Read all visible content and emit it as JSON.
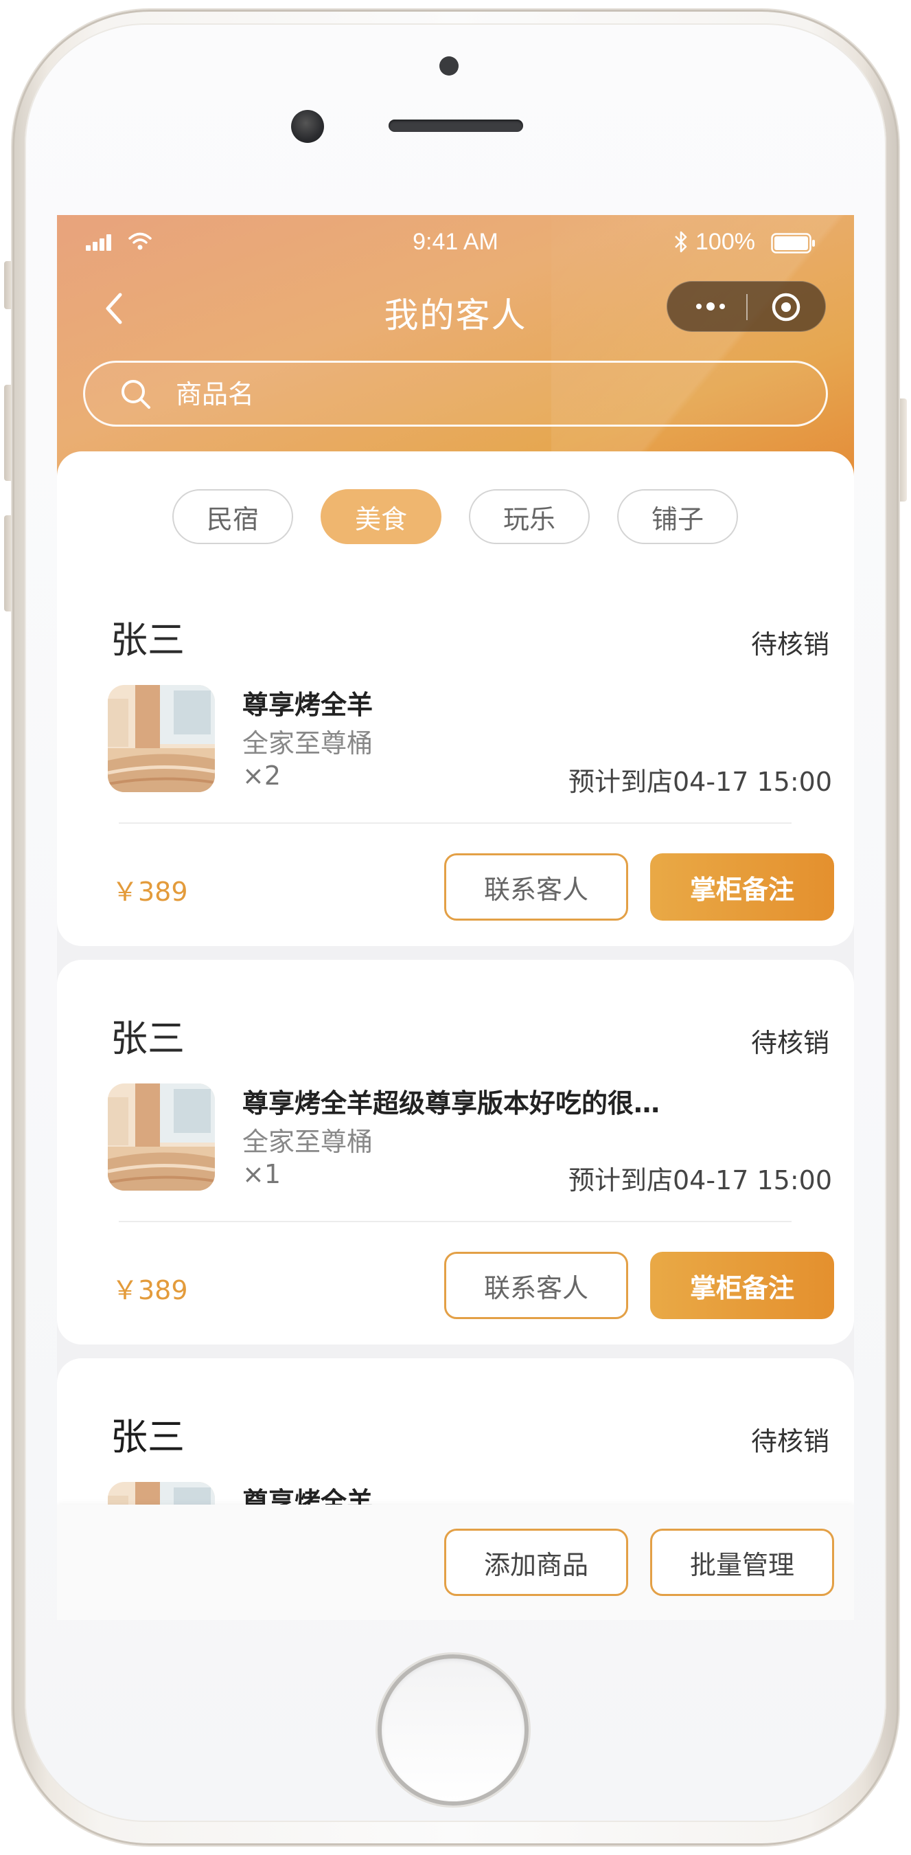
{
  "status_bar": {
    "time": "9:41 AM",
    "battery": "100%"
  },
  "nav": {
    "title": "我的客人"
  },
  "search": {
    "placeholder": "商品名"
  },
  "tabs": [
    {
      "label": "民宿",
      "active": false
    },
    {
      "label": "美食",
      "active": true
    },
    {
      "label": "玩乐",
      "active": false
    },
    {
      "label": "铺子",
      "active": false
    }
  ],
  "orders": [
    {
      "name": "张三",
      "status": "待核销",
      "product_title": "尊享烤全羊",
      "product_spec": "全家至尊桶",
      "quantity": "×2",
      "arrival": "预计到店04-17 15:00",
      "price": "￥389",
      "contact_label": "联系客人",
      "note_label": "掌柜备注"
    },
    {
      "name": "张三",
      "status": "待核销",
      "product_title": "尊享烤全羊超级尊享版本好吃的很…",
      "product_spec": "全家至尊桶",
      "quantity": "×1",
      "arrival": "预计到店04-17 15:00",
      "price": "￥389",
      "contact_label": "联系客人",
      "note_label": "掌柜备注"
    },
    {
      "name": "张三",
      "status": "待核销",
      "product_title": "尊享烤全羊"
    }
  ],
  "bottom_bar": {
    "add_label": "添加商品",
    "batch_label": "批量管理"
  },
  "colors": {
    "accent": "#e4a044",
    "header_gradient_start": "#e8a37d",
    "header_gradient_end": "#e48d39",
    "tab_active": "#efb66f"
  }
}
